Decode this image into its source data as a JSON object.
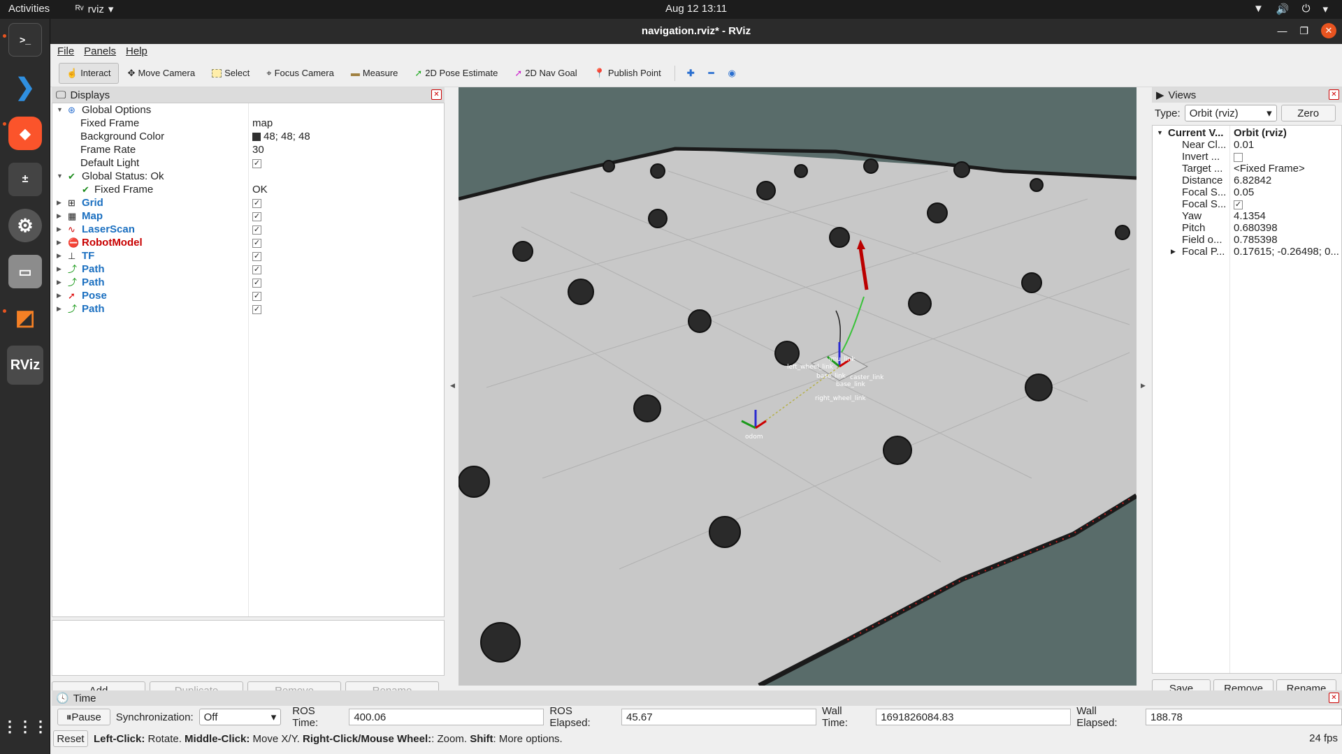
{
  "topbar": {
    "activities": "Activities",
    "app_name": "rviz",
    "clock": "Aug 12  13:11"
  },
  "window": {
    "title": "navigation.rviz* - RViz"
  },
  "menu": [
    "File",
    "Panels",
    "Help"
  ],
  "toolbar": {
    "tools": [
      "Interact",
      "Move Camera",
      "Select",
      "Focus Camera",
      "Measure",
      "2D Pose Estimate",
      "2D Nav Goal",
      "Publish Point"
    ]
  },
  "displays": {
    "title": "Displays",
    "rows": [
      {
        "name": "Global Options",
        "value": ""
      },
      {
        "name": "Fixed Frame",
        "value": "map"
      },
      {
        "name": "Background Color",
        "value": "48; 48; 48"
      },
      {
        "name": "Frame Rate",
        "value": "30"
      },
      {
        "name": "Default Light",
        "value": "✓"
      },
      {
        "name": "Global Status: Ok",
        "value": ""
      },
      {
        "name": "Fixed Frame",
        "value": "OK"
      },
      {
        "name": "Grid",
        "value": "✓"
      },
      {
        "name": "Map",
        "value": "✓"
      },
      {
        "name": "LaserScan",
        "value": "✓"
      },
      {
        "name": "RobotModel",
        "value": "✓"
      },
      {
        "name": "TF",
        "value": "✓"
      },
      {
        "name": "Path",
        "value": "✓"
      },
      {
        "name": "Path",
        "value": "✓"
      },
      {
        "name": "Pose",
        "value": "✓"
      },
      {
        "name": "Path",
        "value": "✓"
      }
    ],
    "buttons": [
      "Add",
      "Duplicate",
      "Remove",
      "Rename"
    ]
  },
  "views": {
    "title": "Views",
    "type_label": "Type:",
    "type_value": "Orbit (rviz)",
    "zero_label": "Zero",
    "header_name": "Current V...",
    "header_value": "Orbit (rviz)",
    "rows": [
      {
        "name": "Near Cl...",
        "value": "0.01"
      },
      {
        "name": "Invert ...",
        "value": ""
      },
      {
        "name": "Target ...",
        "value": "<Fixed Frame>"
      },
      {
        "name": "Distance",
        "value": "6.82842"
      },
      {
        "name": "Focal S...",
        "value": "0.05"
      },
      {
        "name": "Focal S...",
        "value": "✓"
      },
      {
        "name": "Yaw",
        "value": "4.1354"
      },
      {
        "name": "Pitch",
        "value": "0.680398"
      },
      {
        "name": "Field o...",
        "value": "0.785398"
      },
      {
        "name": "Focal P...",
        "value": "0.17615; -0.26498; 0..."
      }
    ],
    "buttons": [
      "Save",
      "Remove",
      "Rename"
    ]
  },
  "scene_labels": {
    "base": "base_link",
    "base2": "base_link",
    "odom": "odom",
    "left": "left_wheel_link",
    "right": "right_wheel_link",
    "imu": "imu_link",
    "caster": "caster_link"
  },
  "time": {
    "title": "Time",
    "pause_label": "Pause",
    "sync_label": "Synchronization:",
    "sync_value": "Off",
    "ros_time_label": "ROS Time:",
    "ros_time": "400.06",
    "ros_elapsed_label": "ROS Elapsed:",
    "ros_elapsed": "45.67",
    "wall_time_label": "Wall Time:",
    "wall_time": "1691826084.83",
    "wall_elapsed_label": "Wall Elapsed:",
    "wall_elapsed": "188.78"
  },
  "help": {
    "reset": "Reset",
    "k1": "Left-Click:",
    "t1": " Rotate. ",
    "k2": "Middle-Click:",
    "t2": " Move X/Y. ",
    "k3": "Right-Click/Mouse Wheel:",
    "t3": ": Zoom. ",
    "k4": "Shift",
    "t4": ": More options.",
    "fps": "24 fps"
  },
  "colors": {
    "accent": "#e95420",
    "scene_bg": "#596c6a",
    "floor": "#c8c8c8"
  }
}
